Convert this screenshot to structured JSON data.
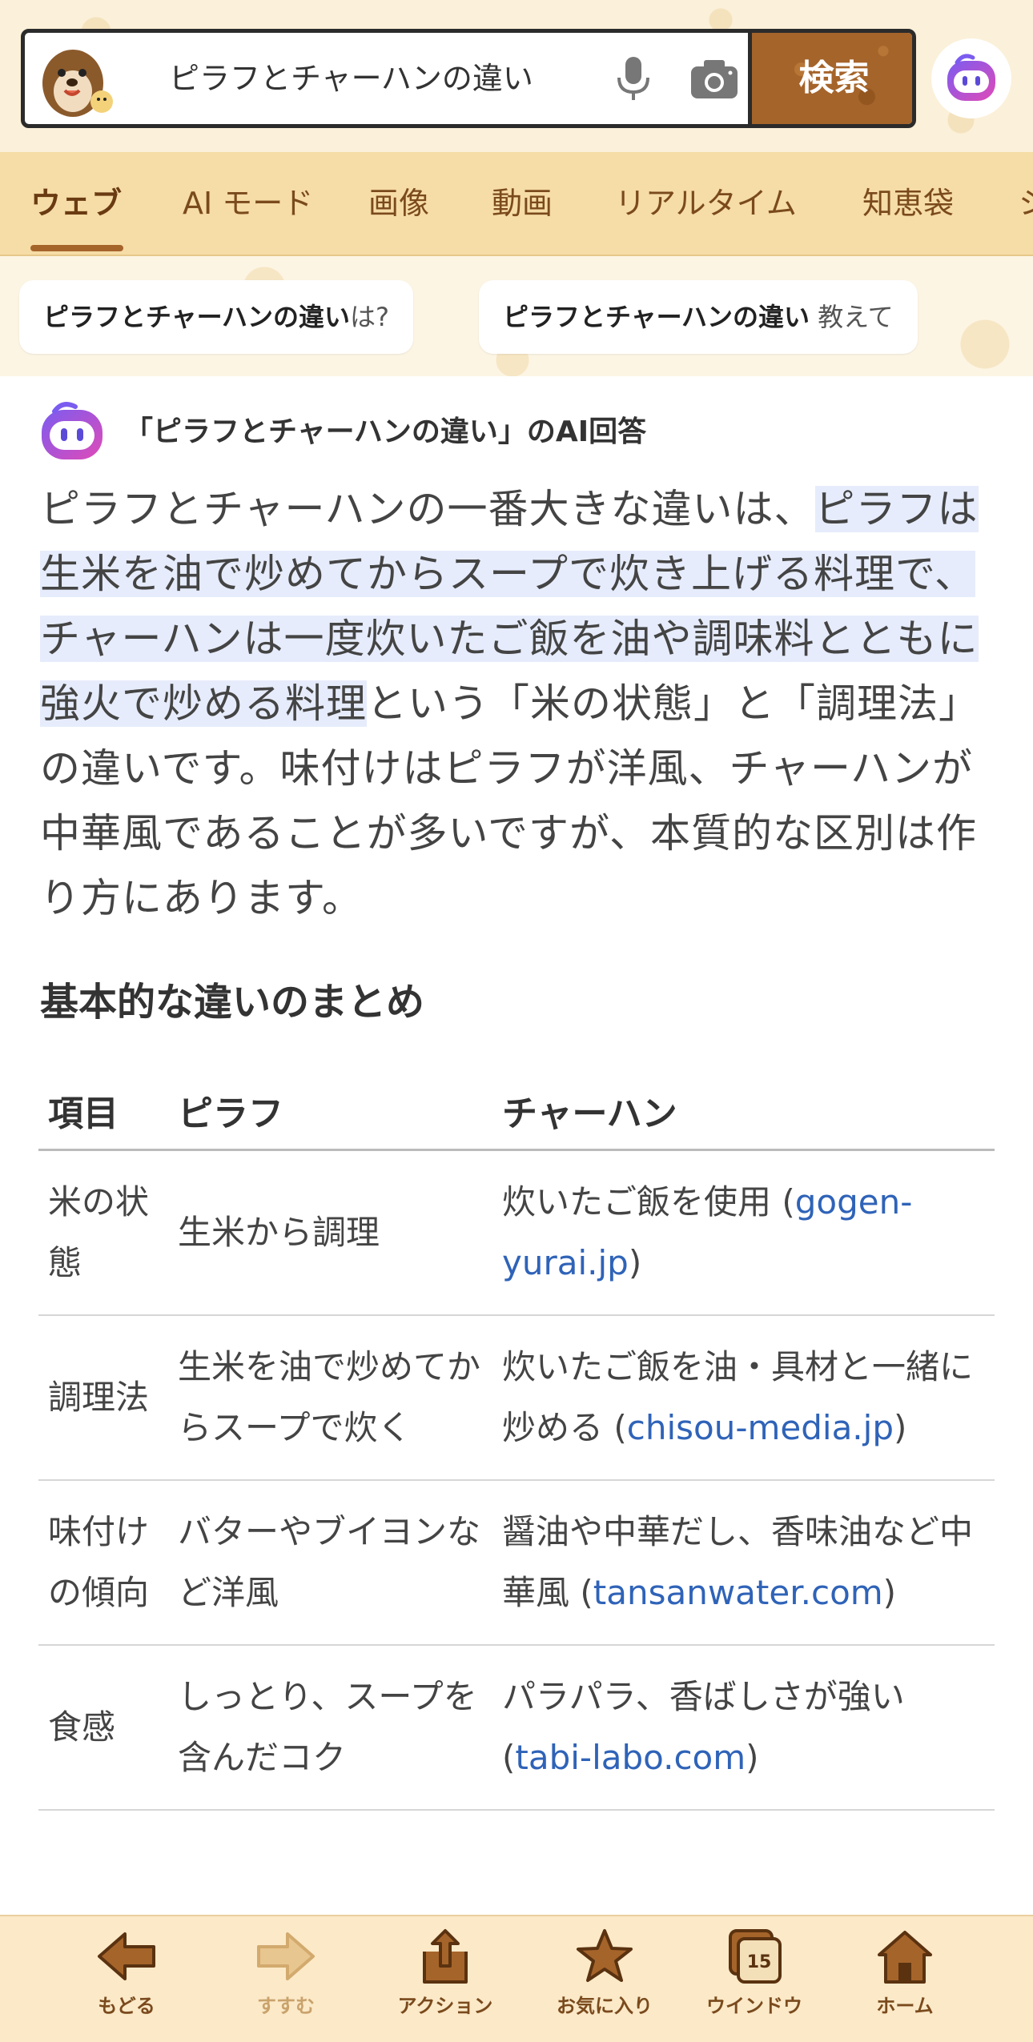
{
  "search": {
    "query": "ピラフとチャーハンの違い",
    "button_label": "検索"
  },
  "tabs": [
    {
      "label": "ウェブ",
      "active": true
    },
    {
      "label": "AI モード"
    },
    {
      "label": "画像"
    },
    {
      "label": "動画"
    },
    {
      "label": "リアルタイム"
    },
    {
      "label": "知恵袋"
    },
    {
      "label": "シ"
    }
  ],
  "chips": [
    {
      "bold": "ピラフとチャーハンの違い",
      "suffix": "は?"
    },
    {
      "bold": "ピラフとチャーハンの違い",
      "suffix": " 教えて"
    }
  ],
  "ai_answer": {
    "heading": "「ピラフとチャーハンの違い」のAI回答",
    "text_before": "ピラフとチャーハンの一番大きな違いは、",
    "text_highlight": "ピラフは生米を油で炒めてからスープで炊き上げる料理で、チャーハンは一度炊いたご飯を油や調味料とともに強火で炒める料理",
    "text_after": "という「米の状態」と「調理法」の違いです。味付けはピラフが洋風、チャーハンが中華風であることが多いですが、本質的な区別は作り方にあります。"
  },
  "section_title": "基本的な違いのまとめ",
  "table": {
    "headers": [
      "項目",
      "ピラフ",
      "チャーハン"
    ],
    "rows": [
      {
        "item": "米の状態",
        "pilaf": "生米から調理",
        "fried": "炊いたご飯を使用 (",
        "link": "gogen-yurai.jp",
        "close": ")"
      },
      {
        "item": "調理法",
        "pilaf": "生米を油で炒めてからスープで炊く",
        "fried": "炊いたご飯を油・具材と一緒に炒める (",
        "link": "chisou-media.jp",
        "close": ")"
      },
      {
        "item": "味付けの傾向",
        "pilaf": "バターやブイヨンなど洋風",
        "fried": "醤油や中華だし、香味油など中華風 (",
        "link": "tansanwater.com",
        "close": ")"
      },
      {
        "item": "食感",
        "pilaf": "しっとり、スープを含んだコク",
        "fried": "パラパラ、香ばしさが強い (",
        "link": "tabi-labo.com",
        "close": ")"
      }
    ]
  },
  "toolbar": {
    "back": "もどる",
    "forward": "すすむ",
    "action": "アクション",
    "favorite": "お気に入り",
    "window": "ウインドウ",
    "window_count": "15",
    "home": "ホーム"
  },
  "colors": {
    "accent_brown": "#a5642a",
    "tab_bg": "#f6dca6",
    "link_blue": "#2f63b8",
    "highlight": "#e6ecfb"
  }
}
